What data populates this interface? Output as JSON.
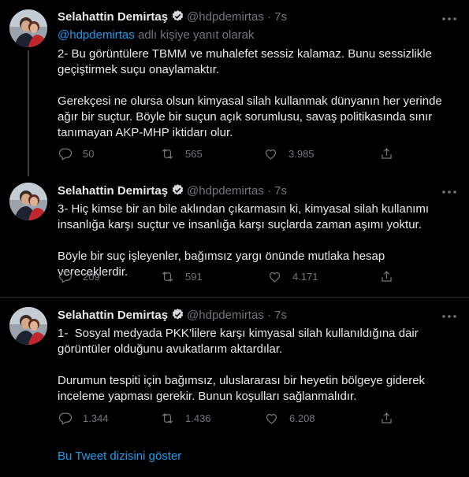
{
  "tweets": [
    {
      "name": "Selahattin Demirtaş",
      "handle": "@hdpdemirtas",
      "separator": "·",
      "time": "7s",
      "reply_mention": "@hdpdemirtas",
      "reply_suffix": " adlı kişiye yanıt olarak",
      "text": "2- Bu görüntülere TBMM ve muhalefet sessiz kalamaz. Bunu sessizlikle geçiştirmek suçu onaylamaktır.\n\nGerekçesi ne olursa olsun kimyasal silah kullanmak dünyanın her yerinde ağır bir suçtur. Böyle bir suçun açık sorumlusu, savaş politikasında sınır tanımayan AKP-MHP iktidarı olur.",
      "replies": "50",
      "retweets": "565",
      "likes": "3.985"
    },
    {
      "name": "Selahattin Demirtaş",
      "handle": "@hdpdemirtas",
      "separator": "·",
      "time": "7s",
      "text": "3- Hiç kimse bir an bile aklından çıkarmasın ki, kimyasal silah kullanımı insanlığa karşı suçtur ve insanlığa karşı suçlarda zaman aşımı yoktur.\n\nBöyle bir suç işleyenler, bağımsız yargı önünde mutlaka hesap vereceklerdir.",
      "replies": "209",
      "retweets": "591",
      "likes": "4.171"
    },
    {
      "name": "Selahattin Demirtaş",
      "handle": "@hdpdemirtas",
      "separator": "·",
      "time": "7s",
      "text": "1-  Sosyal medyada PKK’lilere karşı kimyasal silah kullanıldığına dair görüntüler olduğunu avukatlarım aktardılar.\n\nDurumun tespiti için bağımsız, uluslararası bir heyetin bölgeye giderek inceleme yapması gerekir. Bunun koşulları sağlanmalıdır.",
      "replies": "1.344",
      "retweets": "1.436",
      "likes": "6.208"
    }
  ],
  "show_thread_label": "Bu Tweet dizisini göster",
  "colors": {
    "background": "#000000",
    "text": "#e7e9ea",
    "secondary": "#71767b",
    "link": "#1d9bf0",
    "divider": "#2f3336"
  },
  "icons": [
    "verified-badge-icon",
    "more-options-icon",
    "reply-icon",
    "retweet-icon",
    "like-icon",
    "share-icon"
  ]
}
